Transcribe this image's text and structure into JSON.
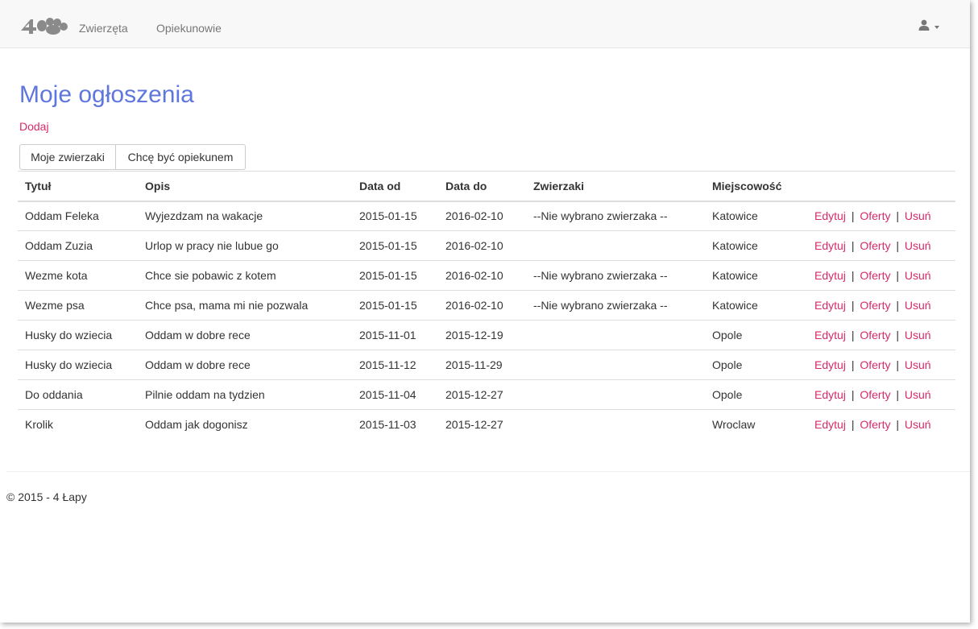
{
  "navbar": {
    "links": [
      {
        "label": "Zwierzęta"
      },
      {
        "label": "Opiekunowie"
      }
    ]
  },
  "main": {
    "title": "Moje ogłoszenia",
    "add_label": "Dodaj",
    "tabs": [
      {
        "label": "Moje zwierzaki"
      },
      {
        "label": "Chcę być opiekunem"
      }
    ],
    "table": {
      "headers": [
        "Tytuł",
        "Opis",
        "Data od",
        "Data do",
        "Zwierzaki",
        "Miejscowość",
        ""
      ],
      "action_labels": {
        "edit": "Edytuj",
        "offers": "Oferty",
        "delete": "Usuń",
        "separator": "|"
      },
      "rows": [
        {
          "title": "Oddam Feleka",
          "desc": "Wyjezdzam na wakacje",
          "from": "2015-01-15",
          "to": "2016-02-10",
          "animals": "--Nie wybrano zwierzaka --",
          "city": "Katowice"
        },
        {
          "title": "Oddam Zuzia",
          "desc": "Urlop w pracy nie lubue go",
          "from": "2015-01-15",
          "to": "2016-02-10",
          "animals": "",
          "city": "Katowice"
        },
        {
          "title": "Wezme kota",
          "desc": "Chce sie pobawic z kotem",
          "from": "2015-01-15",
          "to": "2016-02-10",
          "animals": "--Nie wybrano zwierzaka --",
          "city": "Katowice"
        },
        {
          "title": "Wezme psa",
          "desc": "Chce psa, mama mi nie pozwala",
          "from": "2015-01-15",
          "to": "2016-02-10",
          "animals": "--Nie wybrano zwierzaka --",
          "city": "Katowice"
        },
        {
          "title": "Husky do wziecia",
          "desc": "Oddam w dobre rece",
          "from": "2015-11-01",
          "to": "2015-12-19",
          "animals": "",
          "city": "Opole"
        },
        {
          "title": "Husky do wziecia",
          "desc": "Oddam w dobre rece",
          "from": "2015-11-12",
          "to": "2015-11-29",
          "animals": "",
          "city": "Opole"
        },
        {
          "title": "Do oddania",
          "desc": "Pilnie oddam na tydzien",
          "from": "2015-11-04",
          "to": "2015-12-27",
          "animals": "",
          "city": "Opole"
        },
        {
          "title": "Krolik",
          "desc": "Oddam jak dogonisz",
          "from": "2015-11-03",
          "to": "2015-12-27",
          "animals": "",
          "city": "Wroclaw"
        }
      ]
    }
  },
  "footer": {
    "text": "© 2015 - 4 Łapy"
  },
  "colors": {
    "title": "#5f76dd",
    "link": "#d72a69",
    "navbar_bg": "#f8f8f8"
  },
  "icons": {
    "brand": "paw-logo-icon",
    "user": "user-icon",
    "dropdown": "caret-down-icon"
  }
}
